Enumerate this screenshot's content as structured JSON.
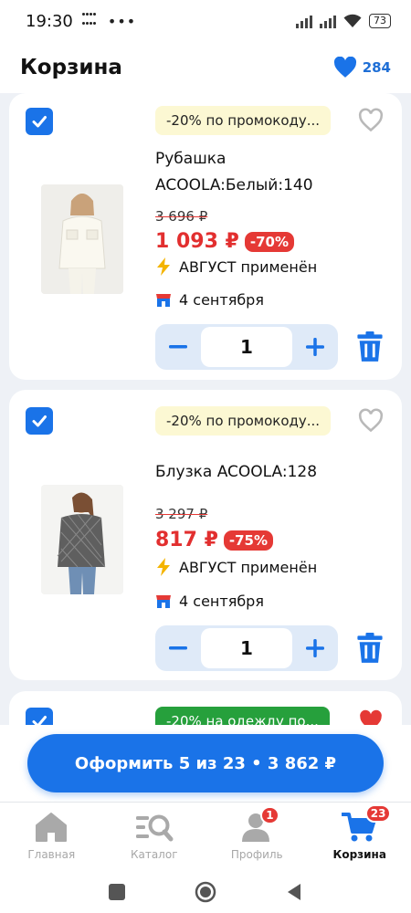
{
  "status_bar": {
    "time": "19:30",
    "dots": "•••",
    "battery": "73"
  },
  "header": {
    "title": "Корзина",
    "favorites_count": "284"
  },
  "cart_items": [
    {
      "promo": "-20% по промокоду...",
      "name": "Рубашка ACOOLA:Белый:140",
      "old_price": "3 696 ₽",
      "price": "1 093 ₽",
      "discount": "-70%",
      "promo_applied": "АВГУСТ применён",
      "delivery": "4 сентября",
      "quantity": "1",
      "checked": true
    },
    {
      "promo": "-20% по промокоду...",
      "name": "Блузка ACOOLA:128",
      "old_price": "3 297 ₽",
      "price": "817 ₽",
      "discount": "-75%",
      "promo_applied": "АВГУСТ применён",
      "delivery": "4 сентября",
      "quantity": "1",
      "checked": true
    },
    {
      "promo": "-20% на одежду по...",
      "checked": true,
      "favorited": true
    }
  ],
  "checkout": {
    "label": "Оформить 5 из 23 • 3 862 ₽"
  },
  "tabbar": {
    "items": [
      {
        "label": "Главная",
        "icon": "home-icon"
      },
      {
        "label": "Каталог",
        "icon": "catalog-search-icon"
      },
      {
        "label": "Профиль",
        "icon": "profile-icon",
        "badge": "1"
      },
      {
        "label": "Корзина",
        "icon": "cart-icon",
        "badge": "23",
        "active": true
      }
    ]
  },
  "colors": {
    "accent": "#1a73e8",
    "sale": "#e53935",
    "promo_bg": "#fcf8d3",
    "promo_green": "#26a03c"
  }
}
